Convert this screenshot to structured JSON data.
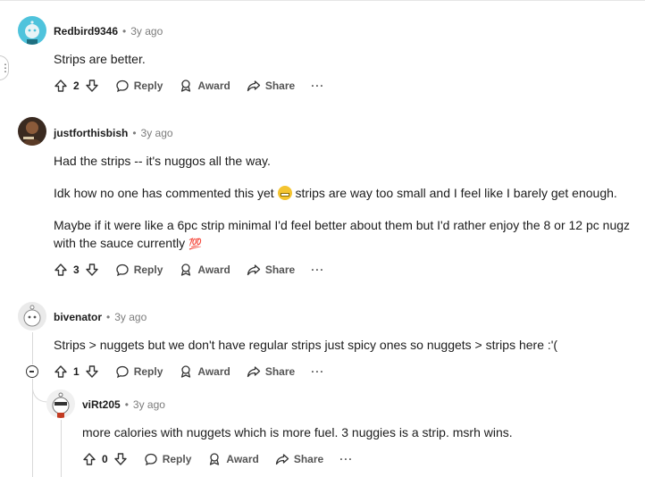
{
  "comments": [
    {
      "author": "Redbird9346",
      "time": "3y ago",
      "paragraphs": [
        "Strips are better."
      ],
      "votes": "2"
    },
    {
      "author": "justforthisbish",
      "time": "3y ago",
      "paragraphs": [
        "Had the strips -- it's nuggos all the way.",
        "Idk how no one has commented this yet",
        "strips are way too small and I feel like I barely get enough.",
        "Maybe if it were like a 6pc strip minimal I'd feel better about them but I'd rather enjoy the 8 or 12 pc nugz with the sauce currently"
      ],
      "votes": "3"
    },
    {
      "author": "bivenator",
      "time": "3y ago",
      "paragraphs": [
        "Strips > nuggets but we don't have regular strips just spicy ones so nuggets > strips here :'("
      ],
      "votes": "1"
    },
    {
      "author": "viRt205",
      "time": "3y ago",
      "paragraphs": [
        "more calories with nuggets which is more fuel. 3 nuggies is a strip. msrh wins."
      ],
      "votes": "0"
    }
  ],
  "actions": {
    "reply": "Reply",
    "award": "Award",
    "share": "Share",
    "more": "···"
  },
  "separator": "•",
  "icons": [
    "upvote-icon",
    "downvote-icon",
    "reply-icon",
    "award-icon",
    "share-icon",
    "more-icon",
    "collapse-icon",
    "avatar"
  ]
}
